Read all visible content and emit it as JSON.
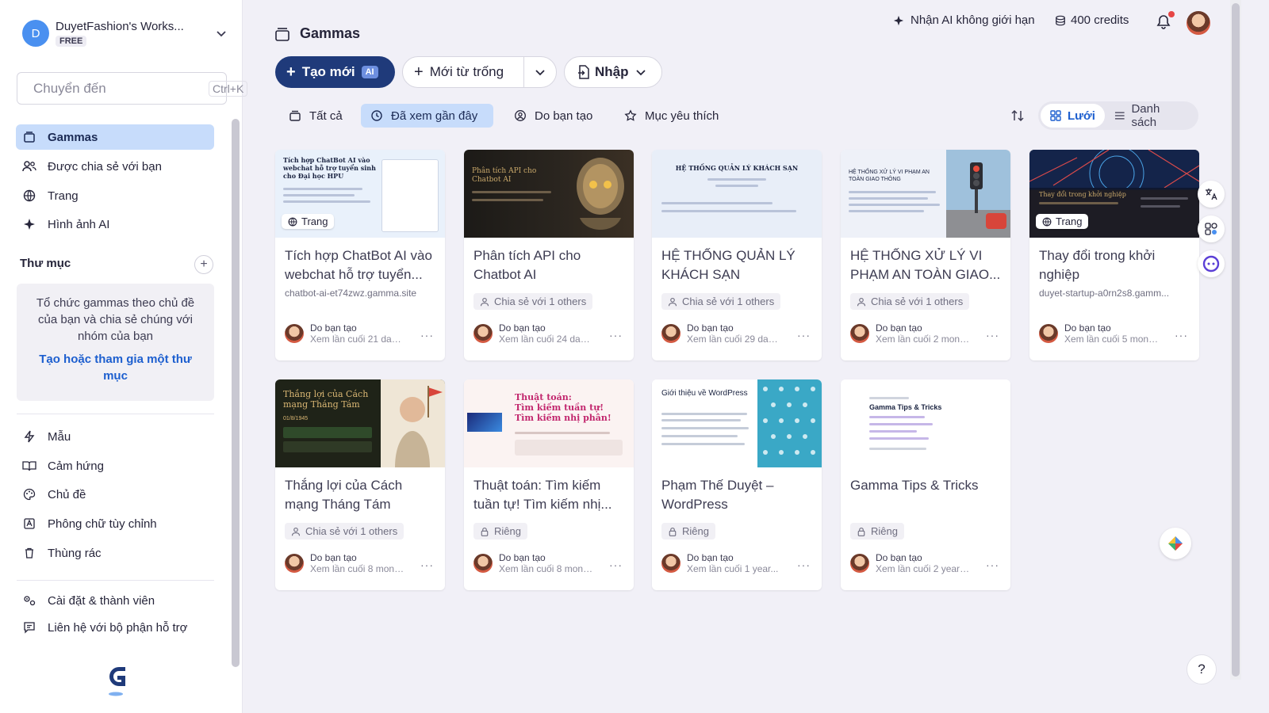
{
  "workspace": {
    "avatar_letter": "D",
    "name": "DuyetFashion's Works...",
    "plan": "FREE"
  },
  "jump": {
    "placeholder": "Chuyển đến",
    "shortcut": "Ctrl+K"
  },
  "sidebar": {
    "primary": [
      {
        "label": "Gammas",
        "icon": "gammas-icon",
        "active": true
      },
      {
        "label": "Được chia sẻ với bạn",
        "icon": "users-icon"
      },
      {
        "label": "Trang",
        "icon": "globe-icon"
      },
      {
        "label": "Hình ảnh AI",
        "icon": "sparkle-icon"
      }
    ],
    "folders_title": "Thư mục",
    "folder_help": "Tổ chức gammas theo chủ đề của bạn và chia sẻ chúng với nhóm của bạn",
    "folder_link": "Tạo hoặc tham gia một thư mục",
    "secondary": [
      {
        "label": "Mẫu",
        "icon": "templates-icon"
      },
      {
        "label": "Cảm hứng",
        "icon": "book-icon"
      },
      {
        "label": "Chủ đề",
        "icon": "palette-icon"
      },
      {
        "label": "Phông chữ tùy chỉnh",
        "icon": "font-icon"
      },
      {
        "label": "Thùng rác",
        "icon": "trash-icon"
      }
    ],
    "footer": [
      {
        "label": "Cài đặt & thành viên",
        "icon": "settings-icon"
      },
      {
        "label": "Liên hệ với bộ phận hỗ trợ",
        "icon": "chat-icon"
      }
    ]
  },
  "header": {
    "title": "Gammas",
    "ai_promo": "Nhận AI không giới hạn",
    "credits": "400 credits"
  },
  "actions": {
    "new_label": "Tạo mới",
    "new_badge": "AI",
    "blank_label": "Mới từ trống",
    "import_label": "Nhập"
  },
  "filters": [
    {
      "label": "Tất cả",
      "icon": "stack-icon"
    },
    {
      "label": "Đã xem gần đây",
      "icon": "clock-icon",
      "active": true
    },
    {
      "label": "Do bạn tạo",
      "icon": "user-circle-icon"
    },
    {
      "label": "Mục yêu thích",
      "icon": "star-icon"
    }
  ],
  "view": {
    "grid_label": "Lưới",
    "list_label": "Danh sách"
  },
  "cards": [
    {
      "title": "Tích hợp ChatBot AI vào webchat hỗ trợ tuyển...",
      "sub": "chatbot-ai-et74zwz.gamma.site",
      "badge": "Trang",
      "author": "Do bạn tạo",
      "seen": "Xem lần cuối 21 days...",
      "thumb_title": "Tích hợp ChatBot AI vào webchat hỗ trợ tuyển sinh cho Đại học HPU"
    },
    {
      "title": "Phân tích API cho Chatbot AI",
      "pill": "Chia sẻ với 1 others",
      "author": "Do bạn tạo",
      "seen": "Xem lần cuối 24 days...",
      "thumb_title": "Phân tích API cho Chatbot AI"
    },
    {
      "title": "HỆ THỐNG QUẢN LÝ KHÁCH SẠN",
      "pill": "Chia sẻ với 1 others",
      "author": "Do bạn tạo",
      "seen": "Xem lần cuối 29 days...",
      "thumb_title": "HỆ THỐNG QUẢN LÝ KHÁCH SẠN"
    },
    {
      "title": "HỆ THỐNG XỬ LÝ VI PHẠM AN TOÀN GIAO...",
      "pill": "Chia sẻ với 1 others",
      "author": "Do bạn tạo",
      "seen": "Xem lần cuối 2 month...",
      "thumb_title": "HỆ THỐNG XỬ LÝ VI PHẠM AN TOÀN GIAO THÔNG"
    },
    {
      "title": "Thay đổi trong khởi nghiệp",
      "sub": "duyet-startup-a0rn2s8.gamm...",
      "badge": "Trang",
      "author": "Do bạn tạo",
      "seen": "Xem lần cuối 5 month...",
      "thumb_title": "Thay đổi trong khởi nghiệp"
    },
    {
      "title": "Thắng lợi của Cách mạng Tháng Tám",
      "pill": "Chia sẻ với 1 others",
      "author": "Do bạn tạo",
      "seen": "Xem lần cuối 8 month...",
      "thumb_title": "Thắng lợi của Cách mạng Tháng Tám",
      "thumb_date": "01/8/1945"
    },
    {
      "title": "Thuật toán: Tìm kiếm tuần tự! Tìm kiếm nhị...",
      "pill": "Riêng",
      "author": "Do bạn tạo",
      "seen": "Xem lần cuối 8 month...",
      "thumb_title": "Thuật toán:",
      "thumb_line2": "Tìm kiếm tuần tự!",
      "thumb_line3": "Tìm kiếm nhị phân!"
    },
    {
      "title": "Phạm Thế Duyệt – WordPress",
      "pill": "Riêng",
      "author": "Do bạn tạo",
      "seen": "Xem lần cuối 1 year...",
      "thumb_title": "Giới thiệu về WordPress"
    },
    {
      "title": "Gamma Tips & Tricks",
      "pill": "Riêng",
      "author": "Do bạn tạo",
      "seen": "Xem lần cuối 2 years...",
      "thumb_title": "Gamma Tips & Tricks"
    }
  ],
  "help": "?",
  "colors": {
    "accent": "#1f3a7a",
    "active_bg": "#c7dcfb",
    "link": "#1d5fcf",
    "page_bg": "#f1f0f7"
  }
}
